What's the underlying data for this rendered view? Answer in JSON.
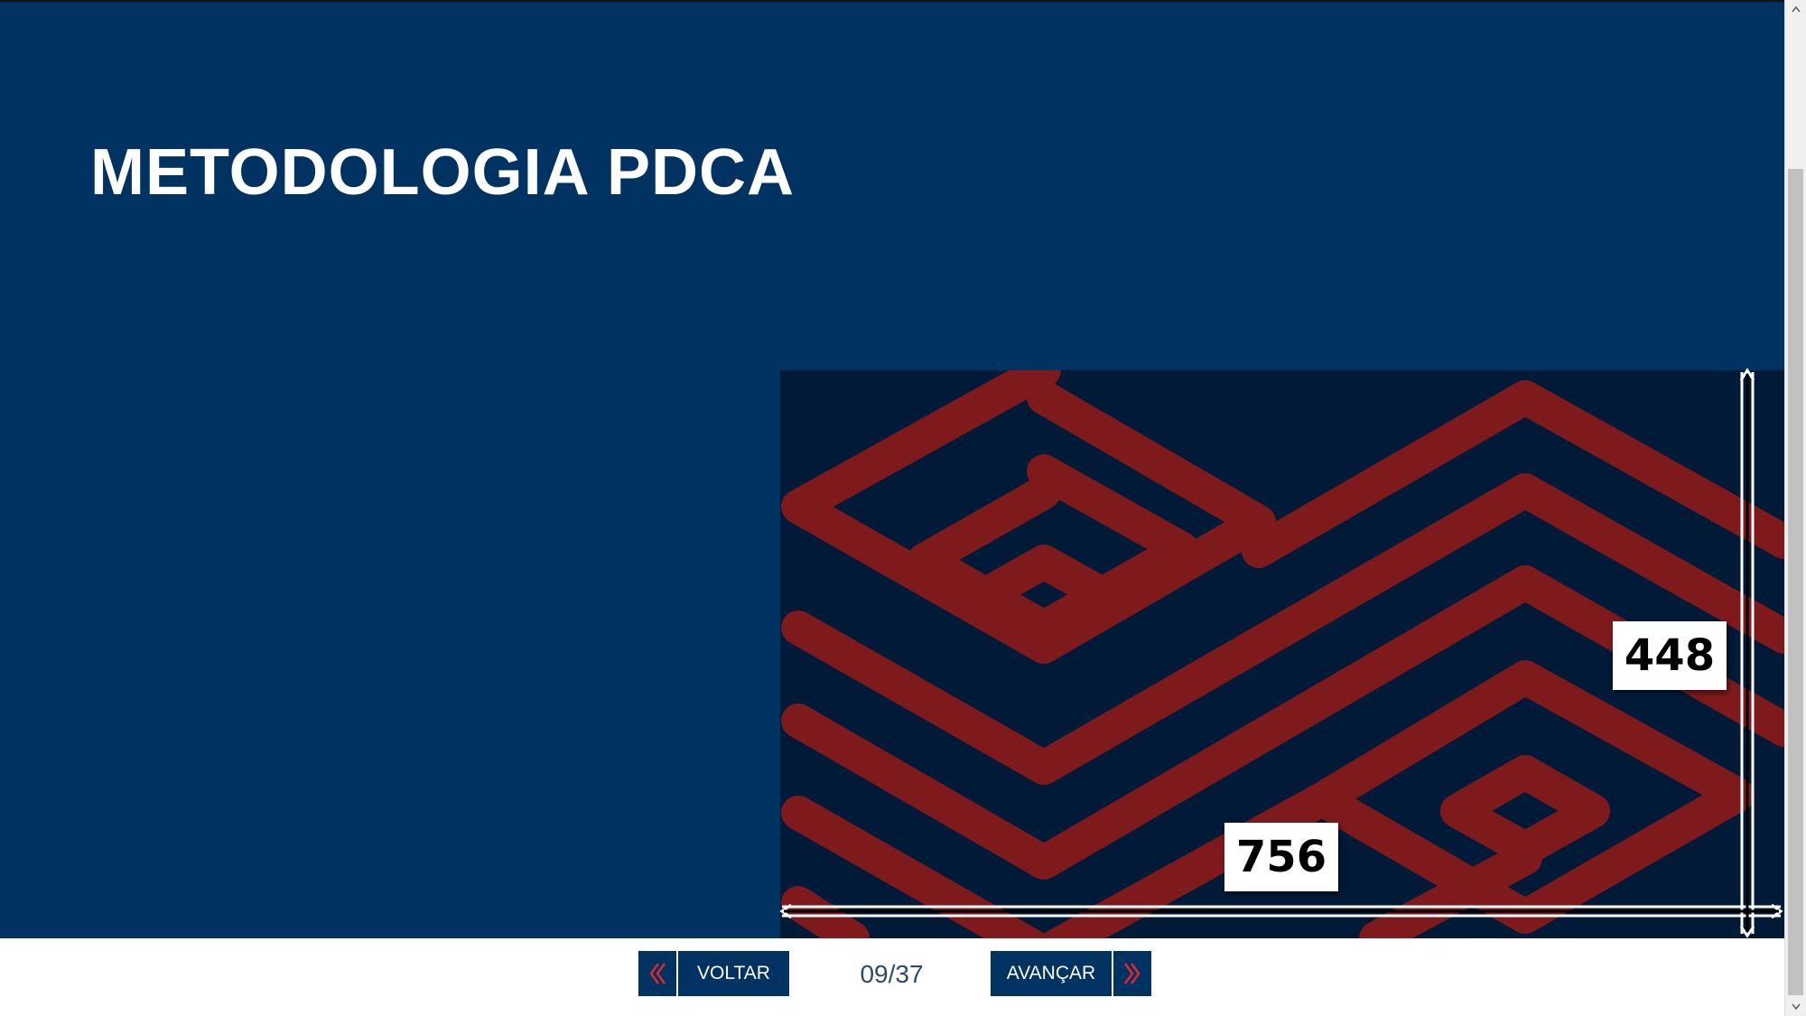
{
  "slide": {
    "title": "METODOLOGIA PDCA",
    "image": {
      "height_label": "448",
      "width_label": "756"
    }
  },
  "navigation": {
    "prev_label": "VOLTAR",
    "next_label": "AVANÇAR",
    "page_counter": "09/37"
  },
  "colors": {
    "slide_background": "#003262",
    "pattern_background": "#011a38",
    "pattern_stroke": "#7f1a1c",
    "button_background": "#003262",
    "nav_arrow": "#e2262a",
    "counter_text": "#2e4a6a"
  },
  "icons": {
    "prev": "double-chevron-left-icon",
    "next": "double-chevron-right-icon",
    "scroll_up": "scroll-up-arrow-icon",
    "scroll_down": "scroll-down-arrow-icon"
  }
}
